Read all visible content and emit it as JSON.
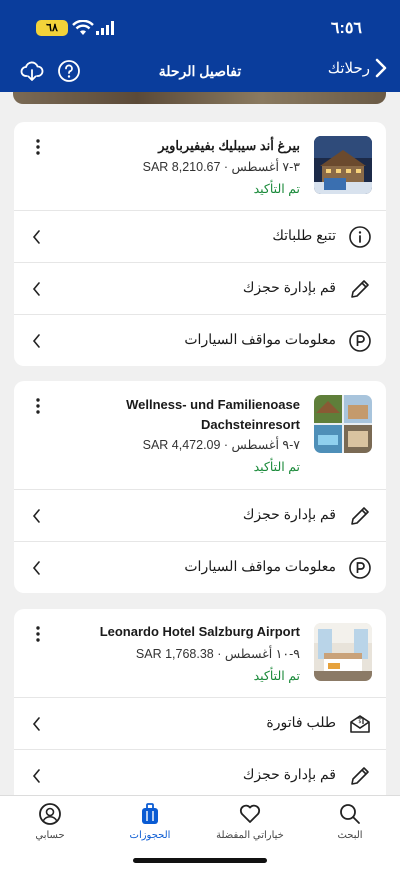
{
  "status_bar": {
    "time": "٦:٥٦",
    "battery": "٦٨"
  },
  "nav": {
    "back_label": "رحلاتك",
    "title": "تفاصيل الرحلة"
  },
  "bookings": [
    {
      "name": "بيرغ أند سيبليك بفيفيرباوير",
      "meta": "٣-٧ أغسطس · SAR 8,210.67",
      "status": "تم التأكيد",
      "actions": [
        {
          "icon": "info-icon",
          "label": "تتبع طلباتك"
        },
        {
          "icon": "pencil-icon",
          "label": "قم بإدارة حجزك"
        },
        {
          "icon": "parking-icon",
          "label": "معلومات مواقف السيارات"
        }
      ]
    },
    {
      "name_line1": "Wellness- und Familienoase",
      "name_line2": "Dachsteinresort",
      "meta": "٧-٩ أغسطس · SAR 4,472.09",
      "status": "تم التأكيد",
      "actions": [
        {
          "icon": "pencil-icon",
          "label": "قم بإدارة حجزك"
        },
        {
          "icon": "parking-icon",
          "label": "معلومات مواقف السيارات"
        }
      ]
    },
    {
      "name": "Leonardo Hotel Salzburg Airport",
      "meta": "٩-١٠ أغسطس · SAR 1,768.38",
      "status": "تم التأكيد",
      "actions": [
        {
          "icon": "invoice-icon",
          "label": "طلب فاتورة"
        },
        {
          "icon": "pencil-icon",
          "label": "قم بإدارة حجزك"
        }
      ]
    }
  ],
  "tabs": [
    {
      "key": "search",
      "label": "البحث",
      "icon": "search-icon"
    },
    {
      "key": "saved",
      "label": "خياراتي المفضلة",
      "icon": "heart-icon"
    },
    {
      "key": "bookings",
      "label": "الحجوزات",
      "icon": "suitcase-icon",
      "active": true
    },
    {
      "key": "account",
      "label": "حسابي",
      "icon": "person-icon"
    }
  ],
  "colors": {
    "header": "#0a3d9c",
    "confirmed": "#1a8a3a",
    "active_tab": "#0a5bd3"
  }
}
